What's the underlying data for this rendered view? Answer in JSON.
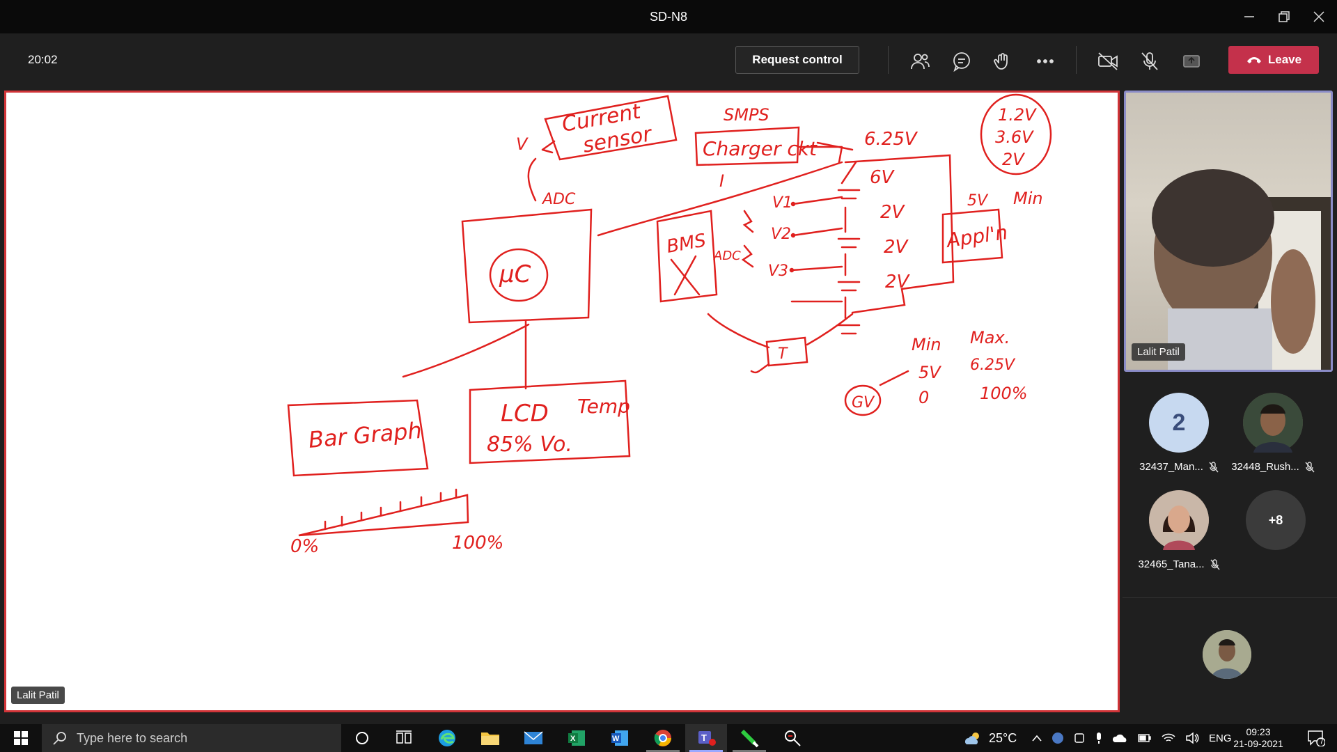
{
  "window": {
    "title": "SD-N8"
  },
  "toolbar": {
    "timer": "20:02",
    "request_control": "Request control",
    "leave": "Leave"
  },
  "stage": {
    "presenter_tag": "Lalit Patil",
    "whiteboard": {
      "current_sensor": [
        "Current",
        "sensor"
      ],
      "v_label": "V",
      "adc_top": "ADC",
      "uc": "µC",
      "smps": "SMPS",
      "charger": "Charger ckt",
      "v625": "6.25V",
      "v6": "6V",
      "cells": [
        "2V",
        "2V",
        "2V"
      ],
      "v5": "5V",
      "min_top": "Min",
      "appln": "Appl'n",
      "bms": "BMS",
      "adc_mid": "ADC",
      "i_label": "I",
      "vlabels": [
        "V1",
        "V2",
        "V3"
      ],
      "t_label": "T",
      "battery_list": [
        "1.2V",
        "3.6V",
        "2V"
      ],
      "min": "Min",
      "max": "Max.",
      "min_val": "5V",
      "max_val": "6.25V",
      "pct_min": "0",
      "pct_max": "100%",
      "gv": "GV",
      "bar_graph": "Bar Graph",
      "lcd": "LCD",
      "temp": "Temp",
      "lcd_vals": "85%  Vo.",
      "scale_start": "0%",
      "scale_end": "100%"
    }
  },
  "speaker": {
    "name": "Lalit Patil"
  },
  "participants": [
    {
      "name": "32437_Man...",
      "avatar_text": "2",
      "avatar_color": "#c7d9f0"
    },
    {
      "name": "32448_Rush...",
      "avatar_text": "",
      "avatar_color": "#6b5a4e"
    },
    {
      "name": "32465_Tana...",
      "avatar_text": "",
      "avatar_color": "#8a6a5a"
    },
    {
      "name": "",
      "avatar_text": "+8",
      "avatar_color": "#3b3b3b"
    }
  ],
  "taskbar": {
    "search_placeholder": "Type here to search",
    "weather": "25°C",
    "lang": "ENG",
    "time": "09:23",
    "date": "21-09-2021",
    "notifications": "7"
  },
  "colors": {
    "leave": "#c4314b",
    "ink": "#e0201e",
    "stage_border": "#d13438",
    "speaker_border": "#8b8cc7"
  }
}
